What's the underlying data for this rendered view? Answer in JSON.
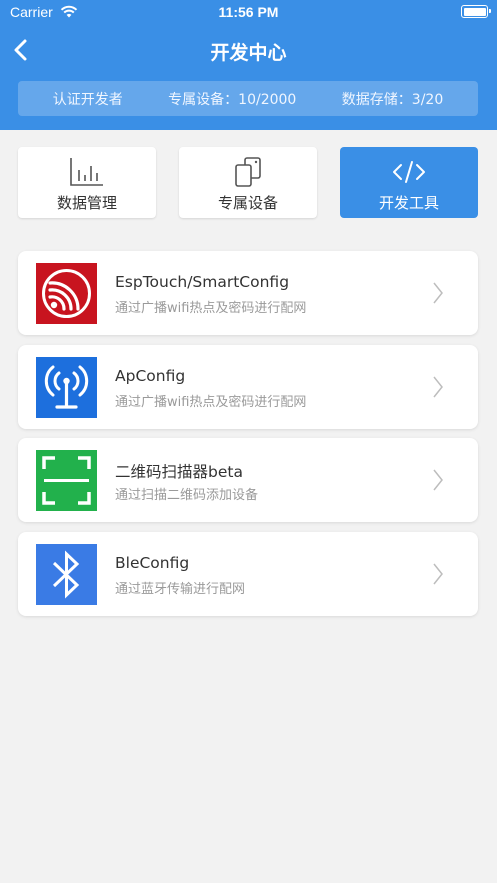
{
  "status_bar": {
    "carrier": "Carrier",
    "time": "11:56 PM"
  },
  "nav": {
    "title": "开发中心"
  },
  "stats": {
    "developer": "认证开发者",
    "devices": "专属设备：10/2000",
    "storage": "数据存储：3/20"
  },
  "tabs": [
    {
      "label": "数据管理",
      "icon": "bar-chart-icon",
      "active": false
    },
    {
      "label": "专属设备",
      "icon": "devices-icon",
      "active": false
    },
    {
      "label": "开发工具",
      "icon": "code-icon",
      "active": true
    }
  ],
  "tools": [
    {
      "name": "EspTouch/SmartConfig",
      "desc": "通过广播wifi热点及密码进行配网",
      "icon": "espressif-logo-icon",
      "color": "#c8141f"
    },
    {
      "name": "ApConfig",
      "desc": "通过广播wifi热点及密码进行配网",
      "icon": "antenna-icon",
      "color": "#1d6fdd"
    },
    {
      "name": "二维码扫描器beta",
      "desc": "通过扫描二维码添加设备",
      "icon": "qr-scan-icon",
      "color": "#22b14c"
    },
    {
      "name": "BleConfig",
      "desc": "通过蓝牙传输进行配网",
      "icon": "bluetooth-icon",
      "color": "#3a7be5"
    }
  ],
  "colors": {
    "primary": "#3a8fe6",
    "background": "#f2f2f2"
  }
}
